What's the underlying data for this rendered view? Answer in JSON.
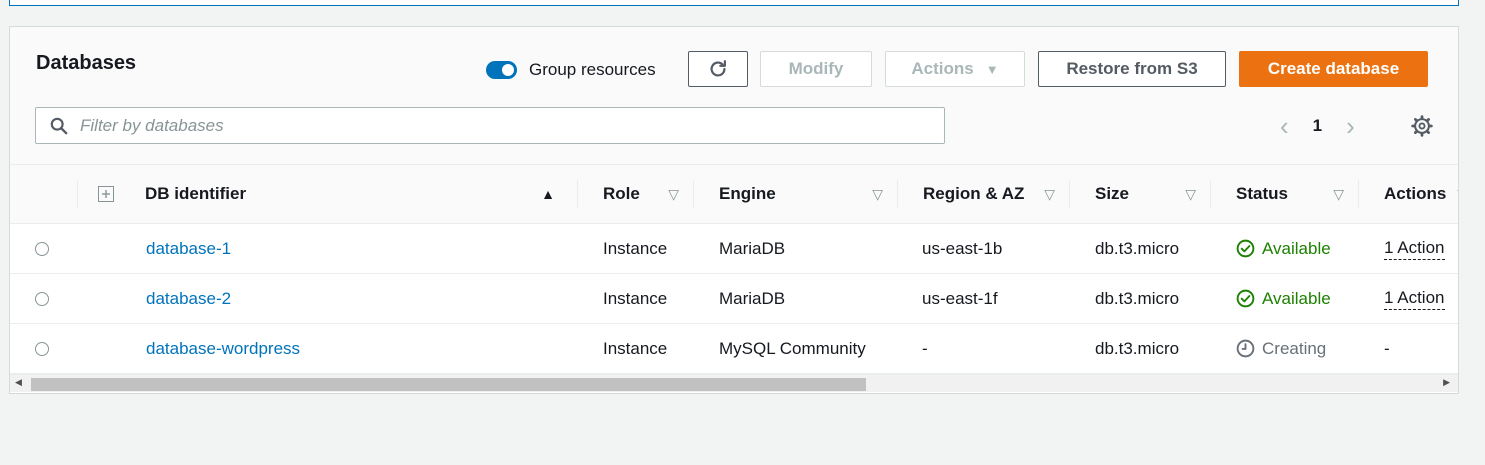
{
  "header": {
    "title": "Databases",
    "group_resources_label": "Group resources",
    "group_resources_on": true
  },
  "toolbar": {
    "modify_label": "Modify",
    "actions_label": "Actions",
    "restore_label": "Restore from S3",
    "create_label": "Create database"
  },
  "search": {
    "placeholder": "Filter by databases",
    "value": ""
  },
  "pagination": {
    "current_page": "1"
  },
  "columns": {
    "identifier": "DB identifier",
    "role": "Role",
    "engine": "Engine",
    "region": "Region & AZ",
    "size": "Size",
    "status": "Status",
    "actions": "Actions"
  },
  "rows": [
    {
      "identifier": "database-1",
      "role": "Instance",
      "engine": "MariaDB",
      "region": "us-east-1b",
      "size": "db.t3.micro",
      "status": "Available",
      "actions": "1 Action"
    },
    {
      "identifier": "database-2",
      "role": "Instance",
      "engine": "MariaDB",
      "region": "us-east-1f",
      "size": "db.t3.micro",
      "status": "Available",
      "actions": "1 Action"
    },
    {
      "identifier": "database-wordpress",
      "role": "Instance",
      "engine": "MySQL Community",
      "region": "-",
      "size": "db.t3.micro",
      "status": "Creating",
      "actions": "-"
    }
  ],
  "colors": {
    "accent": "#0073bb",
    "primary": "#ec7211",
    "success": "#1d8102"
  },
  "icons": [
    "refresh-icon",
    "search-icon",
    "chevron-left-icon",
    "chevron-right-icon",
    "gear-icon",
    "expand-icon",
    "check-circle-icon",
    "clock-icon"
  ]
}
